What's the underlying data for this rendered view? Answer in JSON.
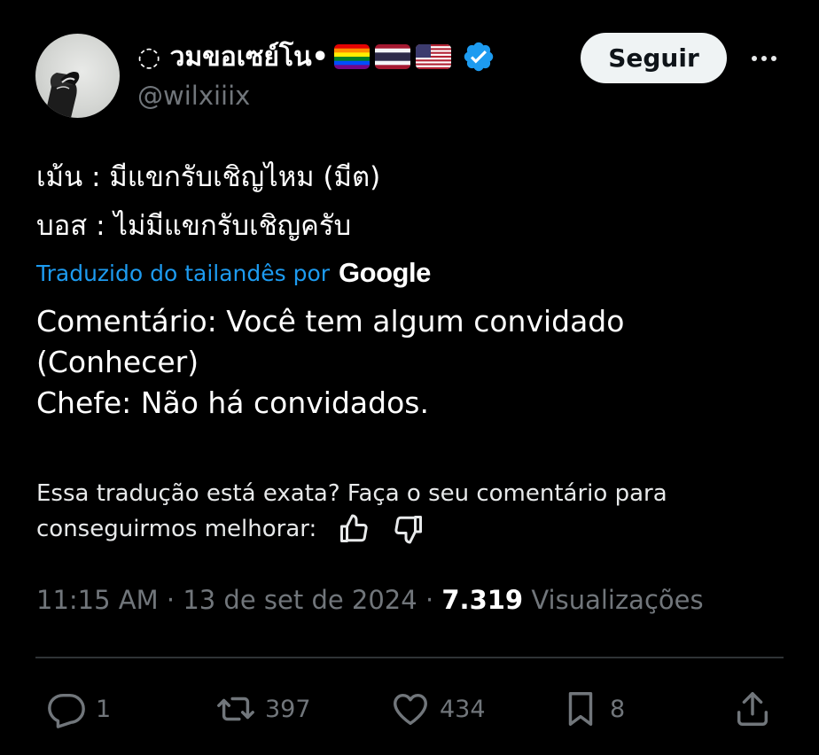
{
  "author": {
    "display_name": "◌ วมขอเซย์โน•",
    "handle": "@wilxiiix",
    "flags": [
      "rainbow-flag-icon",
      "thailand-flag-icon",
      "usa-flag-icon"
    ],
    "verified_icon": "verified-badge-icon"
  },
  "header": {
    "follow_label": "Seguir",
    "more_icon": "more-options-icon"
  },
  "tweet": {
    "line1": "เม้น : มีแขกรับเชิญไหม (มีต)",
    "line2": "บอส : ไม่มีแขกรับเชิญครับ"
  },
  "translation": {
    "attribution": "Traduzido do tailandês por",
    "provider": "Google",
    "lines": [
      "Comentário: Você tem algum convidado",
      "(Conhecer)",
      "Chefe: Não há convidados."
    ]
  },
  "feedback": {
    "line1": "Essa tradução está exata? Faça o seu comentário para",
    "line2": "conseguirmos melhorar:"
  },
  "meta": {
    "time": "11:15 AM",
    "date": "13 de set de 2024",
    "views_count": "7.319",
    "views_label": "Visualizações"
  },
  "actions": {
    "replies": "1",
    "reposts": "397",
    "likes": "434",
    "bookmarks": "8"
  },
  "colors": {
    "background": "#000000",
    "accent": "#1d9bf0",
    "muted": "#71767b",
    "verified": "#1d9bf0"
  }
}
